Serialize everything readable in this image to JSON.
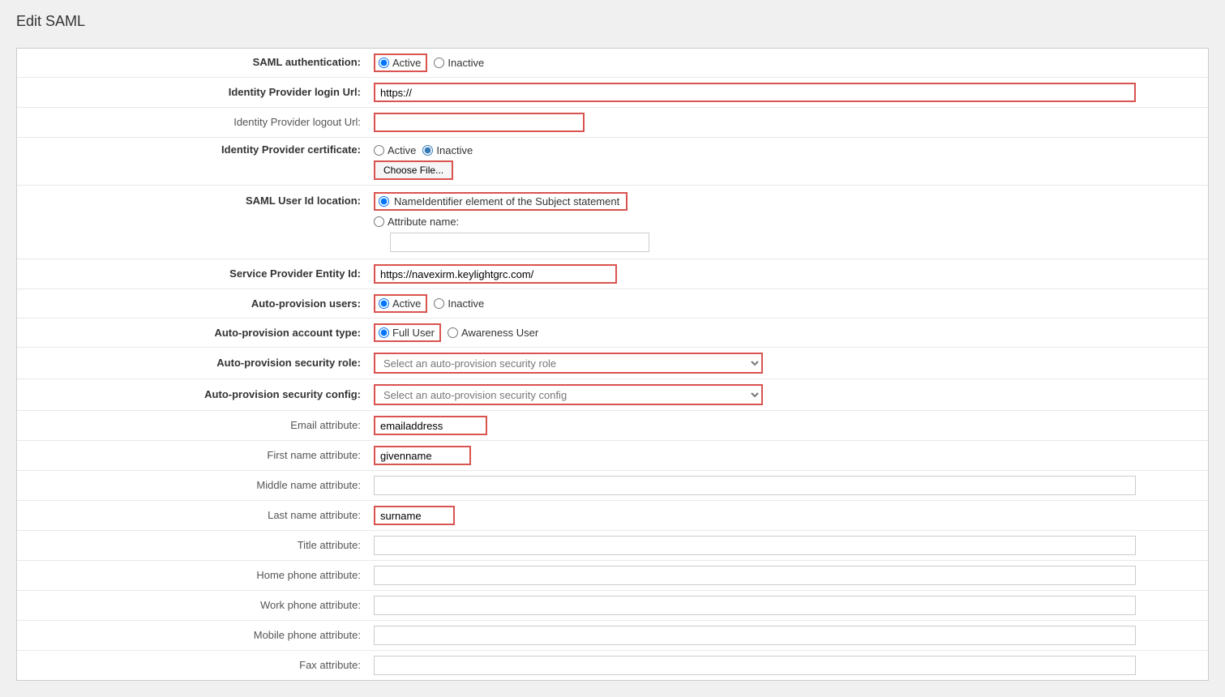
{
  "page": {
    "title": "Edit SAML"
  },
  "form": {
    "saml_auth_label": "SAML authentication:",
    "saml_auth_active_label": "Active",
    "saml_auth_inactive_label": "Inactive",
    "saml_auth_value": "active",
    "idp_login_url_label": "Identity Provider login Url:",
    "idp_login_url_value": "https://",
    "idp_login_url_placeholder": "",
    "idp_logout_url_label": "Identity Provider logout Url:",
    "idp_logout_url_value": "",
    "idp_logout_url_placeholder": "",
    "idp_cert_label": "Identity Provider certificate:",
    "idp_cert_active_label": "Active",
    "idp_cert_inactive_label": "Inactive",
    "idp_cert_value": "inactive",
    "choose_file_label": "Choose File...",
    "saml_uid_location_label": "SAML User Id location:",
    "saml_uid_option1_label": "NameIdentifier element of the Subject statement",
    "saml_uid_option2_label": "Attribute name:",
    "saml_uid_value": "nameid",
    "saml_uid_attr_value": "",
    "sp_entity_id_label": "Service Provider Entity Id:",
    "sp_entity_id_value": "https://navexirm.keylightgrc.com/",
    "auto_provision_users_label": "Auto-provision users:",
    "auto_provision_users_active_label": "Active",
    "auto_provision_users_inactive_label": "Inactive",
    "auto_provision_users_value": "active",
    "auto_provision_type_label": "Auto-provision account type:",
    "auto_provision_type_full_label": "Full User",
    "auto_provision_type_awareness_label": "Awareness User",
    "auto_provision_type_value": "full",
    "auto_provision_role_label": "Auto-provision security role:",
    "auto_provision_role_placeholder": "Select an auto-provision security role",
    "auto_provision_config_label": "Auto-provision security config:",
    "auto_provision_config_placeholder": "Select an auto-provision security config",
    "email_attr_label": "Email attribute:",
    "email_attr_value": "emailaddress",
    "first_name_attr_label": "First name attribute:",
    "first_name_attr_value": "givenname",
    "middle_name_attr_label": "Middle name attribute:",
    "middle_name_attr_value": "",
    "last_name_attr_label": "Last name attribute:",
    "last_name_attr_value": "surname",
    "title_attr_label": "Title attribute:",
    "title_attr_value": "",
    "home_phone_attr_label": "Home phone attribute:",
    "home_phone_attr_value": "",
    "work_phone_attr_label": "Work phone attribute:",
    "work_phone_attr_value": "",
    "mobile_phone_attr_label": "Mobile phone attribute:",
    "mobile_phone_attr_value": "",
    "fax_attr_label": "Fax attribute:",
    "fax_attr_value": ""
  }
}
